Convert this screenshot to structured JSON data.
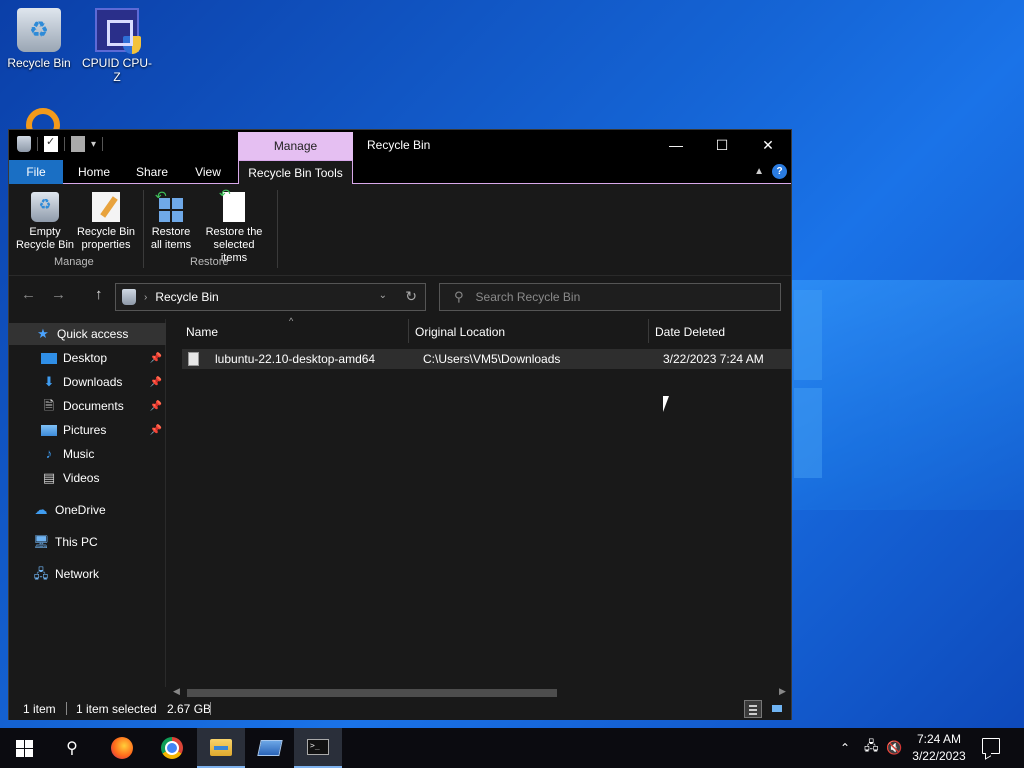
{
  "desktop": {
    "icons": [
      {
        "label": "Recycle Bin"
      },
      {
        "label": "CPUID CPU-Z"
      }
    ]
  },
  "window": {
    "title": "Recycle Bin",
    "context_tab": "Manage",
    "controls": {
      "minimize": "—",
      "maximize": "☐",
      "close": "✕"
    }
  },
  "ribbon_tabs": {
    "file": "File",
    "home": "Home",
    "share": "Share",
    "view": "View",
    "tools": "Recycle Bin Tools"
  },
  "ribbon": {
    "empty": {
      "line1": "Empty",
      "line2": "Recycle Bin"
    },
    "properties": {
      "line1": "Recycle Bin",
      "line2": "properties"
    },
    "restore_all": {
      "line1": "Restore",
      "line2": "all items"
    },
    "restore_selected": {
      "line1": "Restore the",
      "line2": "selected items"
    },
    "groups": {
      "manage": "Manage",
      "restore": "Restore"
    },
    "help": "?"
  },
  "address": {
    "path": "Recycle Bin",
    "search_placeholder": "Search Recycle Bin"
  },
  "nav": {
    "quick_access": "Quick access",
    "items": [
      {
        "label": "Desktop",
        "pinned": true
      },
      {
        "label": "Downloads",
        "pinned": true
      },
      {
        "label": "Documents",
        "pinned": true
      },
      {
        "label": "Pictures",
        "pinned": true
      },
      {
        "label": "Music",
        "pinned": false
      },
      {
        "label": "Videos",
        "pinned": false
      }
    ],
    "onedrive": "OneDrive",
    "this_pc": "This PC",
    "network": "Network"
  },
  "columns": {
    "name": "Name",
    "original_location": "Original Location",
    "date_deleted": "Date Deleted"
  },
  "files": [
    {
      "name": "lubuntu-22.10-desktop-amd64",
      "original_location": "C:\\Users\\VM5\\Downloads",
      "date_deleted": "3/22/2023 7:24 AM"
    }
  ],
  "status": {
    "count": "1 item",
    "selected": "1 item selected",
    "size": "2.67 GB"
  },
  "taskbar": {
    "time": "7:24 AM",
    "date": "3/22/2023"
  },
  "colors": {
    "accent": "#1a6fc4",
    "context_tab": "#e5bff2",
    "window_bg": "#191919"
  }
}
